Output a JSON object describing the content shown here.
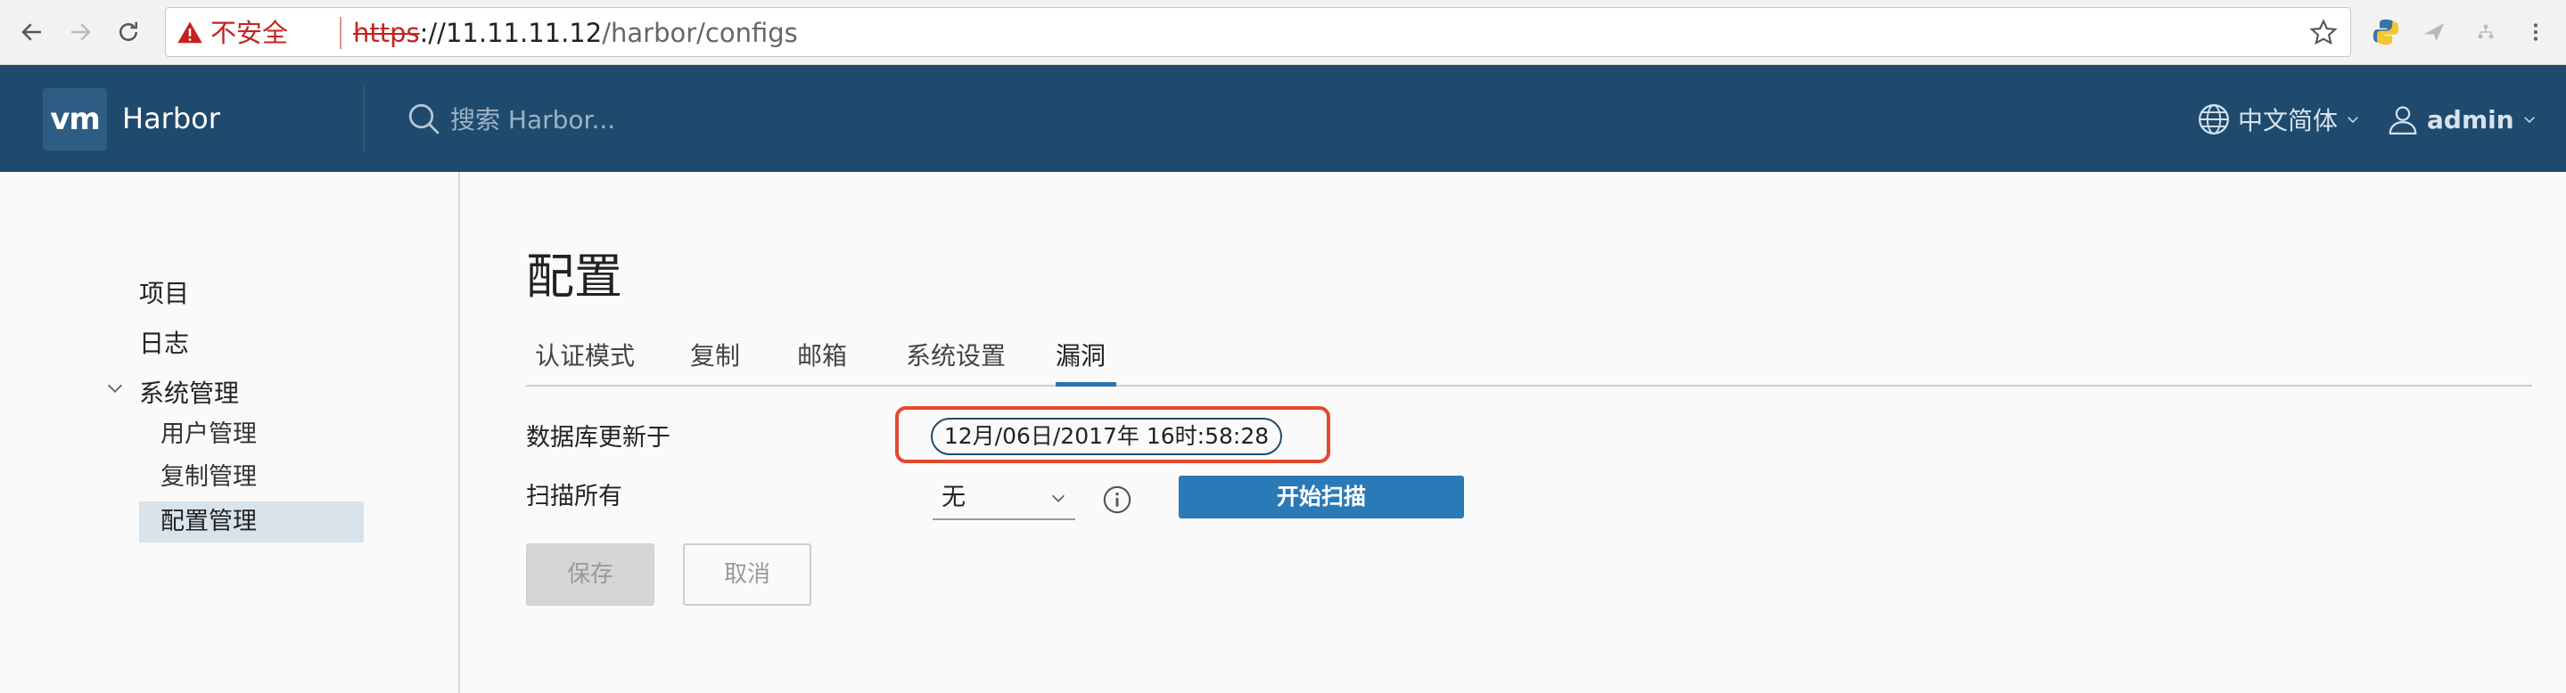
{
  "browser": {
    "insecure_label": "不安全",
    "url_scheme": "https",
    "url_host": "://11.11.11.12",
    "url_path": "/harbor/configs"
  },
  "header": {
    "logo_text": "vm",
    "app_name": "Harbor",
    "search_placeholder": "搜索 Harbor...",
    "language": "中文简体",
    "user": "admin",
    "colors": {
      "header_bg": "#1f4a6e",
      "accent": "#2b73ac"
    }
  },
  "sidebar": {
    "items": [
      {
        "label": "项目"
      },
      {
        "label": "日志"
      },
      {
        "label": "系统管理"
      }
    ],
    "sub_items": [
      {
        "label": "用户管理"
      },
      {
        "label": "复制管理"
      },
      {
        "label": "配置管理",
        "active": true
      }
    ]
  },
  "main": {
    "title": "配置",
    "tabs": [
      {
        "label": "认证模式"
      },
      {
        "label": "复制"
      },
      {
        "label": "邮箱"
      },
      {
        "label": "系统设置"
      },
      {
        "label": "漏洞",
        "active": true
      }
    ],
    "db_updated_label": "数据库更新于",
    "db_updated_value": "12月/06日/2017年 16时:58:28",
    "scan_all_label": "扫描所有",
    "scan_schedule_value": "无",
    "scan_now_button": "开始扫描",
    "save_button": "保存",
    "cancel_button": "取消"
  }
}
